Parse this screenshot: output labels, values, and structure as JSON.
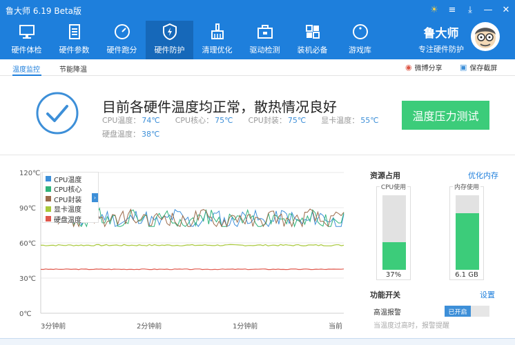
{
  "app": {
    "title": "鲁大师 6.19 Beta版"
  },
  "nav": [
    {
      "label": "硬件体检",
      "icon": "monitor-icon"
    },
    {
      "label": "硬件参数",
      "icon": "document-icon"
    },
    {
      "label": "硬件跑分",
      "icon": "gauge-icon"
    },
    {
      "label": "硬件防护",
      "icon": "shield-icon"
    },
    {
      "label": "清理优化",
      "icon": "broom-icon"
    },
    {
      "label": "驱动检测",
      "icon": "toolbox-icon"
    },
    {
      "label": "装机必备",
      "icon": "apps-grid-icon"
    },
    {
      "label": "游戏库",
      "icon": "game-icon"
    }
  ],
  "brand": {
    "name": "鲁大师",
    "tagline": "专注硬件防护"
  },
  "subnav": {
    "tab1": "温度监控",
    "tab2": "节能降温",
    "share": "微博分享",
    "screenshot": "保存截屏"
  },
  "status": {
    "title": "目前各硬件温度均正常，散热情况良好",
    "temps": [
      {
        "label": "CPU温度：",
        "value": "74℃"
      },
      {
        "label": "CPU核心：",
        "value": "75℃"
      },
      {
        "label": "CPU封装：",
        "value": "75℃"
      },
      {
        "label": "显卡温度：",
        "value": "55℃"
      },
      {
        "label": "硬盘温度：",
        "value": "38℃"
      }
    ],
    "stress_button": "温度压力测试"
  },
  "chart_data": {
    "type": "line",
    "ylim": [
      0,
      120
    ],
    "y_ticks": [
      "120℃",
      "90℃",
      "60℃",
      "30℃",
      "0℃"
    ],
    "x_ticks": [
      "3分钟前",
      "2分钟前",
      "1分钟前",
      "当前"
    ],
    "series": [
      {
        "name": "CPU温度",
        "color": "#3d8fd8"
      },
      {
        "name": "CPU核心",
        "color": "#2fb37a"
      },
      {
        "name": "CPU封装",
        "color": "#9a6a4a"
      },
      {
        "name": "显卡温度",
        "color": "#a8c83a"
      },
      {
        "name": "硬盘温度",
        "color": "#e0574b"
      }
    ],
    "gpu_level": 58,
    "disk_level": 37.5,
    "cpu_range": [
      74,
      95
    ]
  },
  "resources": {
    "title": "资源占用",
    "optimize": "优化内存",
    "cpu_label": "CPU使用",
    "cpu_value": "37%",
    "cpu_fraction": 0.37,
    "mem_label": "内存使用",
    "mem_value": "6.1 GB",
    "mem_fraction": 0.76
  },
  "functions": {
    "title": "功能开关",
    "settings": "设置",
    "alarm_label": "高温报警",
    "alarm_state": "已开启",
    "alarm_note": "当温度过高时，报警提醒"
  }
}
